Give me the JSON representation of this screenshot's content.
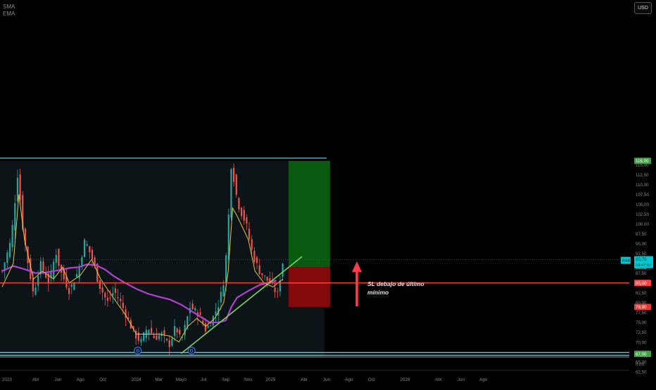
{
  "legend": {
    "sma_label": "SMA",
    "ema_label": "EMA"
  },
  "toolbar": {
    "currency": "USD"
  },
  "annotation": {
    "line1": "SL debajo de último",
    "line2": "mínimo"
  },
  "colors": {
    "bull": "#26a69a",
    "bear": "#ef5350",
    "sma": "#e8c340",
    "ema": "#b23fd0",
    "trendline": "#7ad06b",
    "channel": "#4fd1e8",
    "resistance": "#ff4040",
    "target_zone": "#0a5e10",
    "stop_zone": "#8a0b0b",
    "axis_text": "#8a8a8a"
  },
  "chart_data": {
    "type": "candlestick",
    "symbol": "BABA",
    "currency": "USD",
    "ylim": [
      60.8,
      117.8
    ],
    "y_ticks": [
      "115,00",
      "112,50",
      "110,00",
      "107,50",
      "105,00",
      "102,50",
      "100,00",
      "97,50",
      "95,00",
      "92,50",
      "87,50",
      "85,00",
      "82,50",
      "80,00",
      "77,50",
      "75,00",
      "72,50",
      "70,00",
      "67,50",
      "65,00",
      "62,50",
      "0,00"
    ],
    "x_ticks": [
      "2023",
      "Abr",
      "Jun",
      "Ago",
      "Oct",
      "2024",
      "Mar",
      "Mayo",
      "Jul",
      "Sep",
      "Nov",
      "2025",
      "Abr",
      "Jun",
      "Ago",
      "Oct",
      "2026",
      "Abr",
      "Jun",
      "Ago"
    ],
    "x_tick_dates": [
      "2023-01",
      "2023-04",
      "2023-06",
      "2023-08",
      "2023-10",
      "2024-01",
      "2024-03",
      "2024-05",
      "2024-07",
      "2024-09",
      "2024-11",
      "2025-01",
      "2025-04",
      "2025-06",
      "2025-08",
      "2025-10",
      "2026-01",
      "2026-04",
      "2026-06",
      "2026-08"
    ],
    "x_tick_months": [
      0,
      3,
      5,
      7,
      9,
      12,
      14,
      16,
      18,
      20,
      22,
      24,
      27,
      29,
      31,
      33,
      36,
      39,
      41,
      43
    ],
    "x_range_months": [
      0,
      44
    ],
    "last_bar_month": 25.1,
    "close_path": [
      [
        0,
        88
      ],
      [
        0.8,
        96
      ],
      [
        1.4,
        113
      ],
      [
        1.8,
        100
      ],
      [
        2.2,
        92
      ],
      [
        2.8,
        82
      ],
      [
        3.4,
        90
      ],
      [
        4.2,
        85
      ],
      [
        4.8,
        93
      ],
      [
        5.2,
        88
      ],
      [
        6.0,
        83
      ],
      [
        6.8,
        88
      ],
      [
        7.4,
        96
      ],
      [
        8.2,
        90
      ],
      [
        8.6,
        85
      ],
      [
        9.4,
        80
      ],
      [
        10.0,
        83
      ],
      [
        10.6,
        80
      ],
      [
        11.2,
        76
      ],
      [
        11.8,
        72
      ],
      [
        12.4,
        70
      ],
      [
        13.0,
        74
      ],
      [
        13.6,
        71
      ],
      [
        14.3,
        72
      ],
      [
        14.9,
        69
      ],
      [
        15.5,
        74
      ],
      [
        16.0,
        70
      ],
      [
        16.8,
        79
      ],
      [
        17.6,
        77
      ],
      [
        18.2,
        73
      ],
      [
        18.8,
        76
      ],
      [
        19.4,
        80
      ],
      [
        19.9,
        87
      ],
      [
        20.2,
        100
      ],
      [
        20.5,
        116.5
      ],
      [
        20.8,
        109
      ],
      [
        21.2,
        104
      ],
      [
        21.8,
        100
      ],
      [
        22.4,
        92
      ],
      [
        23.0,
        88
      ],
      [
        23.6,
        86
      ],
      [
        24.2,
        84
      ],
      [
        24.6,
        82
      ],
      [
        25.1,
        90.75
      ]
    ],
    "sma_path": [
      [
        0,
        84
      ],
      [
        1.0,
        90
      ],
      [
        1.5,
        107.5
      ],
      [
        2.0,
        96
      ],
      [
        2.8,
        86
      ],
      [
        3.6,
        88
      ],
      [
        4.6,
        86
      ],
      [
        5.4,
        89
      ],
      [
        6.0,
        85
      ],
      [
        7.0,
        87
      ],
      [
        8.0,
        91
      ],
      [
        8.8,
        86
      ],
      [
        10.0,
        81
      ],
      [
        11.0,
        77
      ],
      [
        12.0,
        72
      ],
      [
        13.0,
        72
      ],
      [
        14.0,
        72
      ],
      [
        15.0,
        71.5
      ],
      [
        15.8,
        70
      ],
      [
        16.6,
        74
      ],
      [
        17.4,
        76
      ],
      [
        18.2,
        74
      ],
      [
        19.0,
        76
      ],
      [
        19.8,
        80
      ],
      [
        20.2,
        88
      ],
      [
        20.6,
        104
      ],
      [
        21.0,
        102
      ],
      [
        22.0,
        96
      ],
      [
        22.6,
        88
      ],
      [
        23.4,
        85
      ],
      [
        24.2,
        84
      ],
      [
        25.1,
        86
      ]
    ],
    "ema_path": [
      [
        0,
        88
      ],
      [
        1.0,
        89.3
      ],
      [
        2.0,
        88.5
      ],
      [
        3.0,
        87.5
      ],
      [
        4.0,
        87.7
      ],
      [
        5.0,
        88.2
      ],
      [
        6.0,
        88.8
      ],
      [
        6.8,
        89.0
      ],
      [
        7.6,
        89.7
      ],
      [
        8.4,
        89.5
      ],
      [
        9.2,
        88.4
      ],
      [
        10.0,
        86.7
      ],
      [
        11.0,
        85.0
      ],
      [
        12.0,
        83.5
      ],
      [
        13.0,
        82.3
      ],
      [
        14.0,
        81.5
      ],
      [
        15.0,
        80.8
      ],
      [
        16.0,
        79.5
      ],
      [
        17.0,
        77.7
      ],
      [
        17.8,
        76.3
      ],
      [
        18.6,
        74.9
      ],
      [
        19.4,
        75.0
      ],
      [
        20.0,
        75.5
      ],
      [
        20.5,
        79.0
      ],
      [
        21.0,
        81.3
      ],
      [
        22.0,
        83.0
      ],
      [
        23.0,
        84.5
      ],
      [
        24.0,
        85.3
      ],
      [
        24.5,
        85.6
      ]
    ],
    "levels": {
      "resistance": 85.0,
      "channel_top": 116.7,
      "channel_bottom": 67.0,
      "entry": 89.01,
      "last_price": 90.75,
      "stop_loss": 78.9,
      "target": 116.0
    },
    "level_labels": {
      "target": "116,00",
      "last_price": "90,75",
      "countdown": "04:47:57",
      "entry": "89,01",
      "resistance": "85,00",
      "stop_loss": "78,90",
      "channel_bottom": "67,00"
    },
    "trendline": [
      [
        16.0,
        67.1
      ],
      [
        26.8,
        91.7
      ]
    ],
    "position_box": {
      "start_month": 25.6,
      "end_month": 29.3
    },
    "highlight_until_month": 28.8,
    "event_markers": [
      {
        "month": 12.0,
        "label": "D"
      },
      {
        "month": 16.8,
        "label": "D"
      }
    ]
  }
}
